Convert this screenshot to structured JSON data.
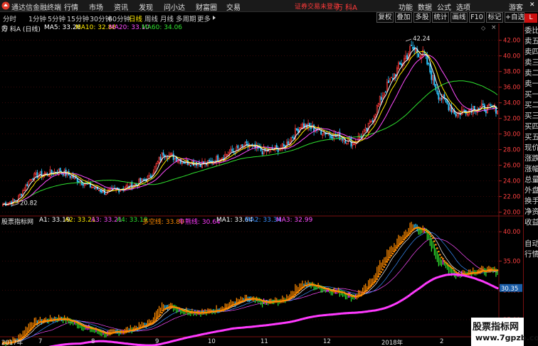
{
  "app": {
    "title": "通达信金融终端"
  },
  "menu": {
    "items": [
      "行情",
      "市场",
      "资讯",
      "发现",
      "问小达",
      "财富圈",
      "交易"
    ]
  },
  "login_text": "证券交易未登录",
  "stock_name": "万 科A",
  "right_menu": {
    "items": [
      "功能",
      "数据",
      "公式",
      "选项",
      "游客"
    ]
  },
  "periods": {
    "items": [
      "分时",
      "1分钟",
      "5分钟",
      "15分钟",
      "30分钟",
      "60分钟",
      "日线",
      "周线",
      "月线",
      "多周期",
      "更多"
    ],
    "active": "日线"
  },
  "toolbar": {
    "items": [
      "复权",
      "叠加",
      "多股",
      "统计",
      "画线",
      "F10",
      "标记",
      "+自选"
    ]
  },
  "ma_legend": {
    "name": "万 科A (日线)",
    "items": [
      {
        "label": "MA5: 33.26",
        "color": "#ffffff"
      },
      {
        "label": "MA10: 32.88",
        "color": "#ffea00"
      },
      {
        "label": "MA20: 33.10",
        "color": "#ff4dff"
      },
      {
        "label": "MA60: 34.06",
        "color": "#2fe12f"
      }
    ]
  },
  "sub_legend": {
    "name": "股票指标网",
    "items": [
      {
        "label": "A1: 33.19",
        "color": "#ffffff"
      },
      {
        "label": "A2: 33.21",
        "color": "#ffea00"
      },
      {
        "label": "A3: 33.21",
        "color": "#ff4dff"
      },
      {
        "label": "A4: 33.19",
        "color": "#2fe12f"
      },
      {
        "label": "多空线: 33.80",
        "color": "#ff8a00"
      },
      {
        "label": "牛熊线: 30.64",
        "color": "#ff3aff"
      },
      {
        "label": "MA1: 33.64",
        "color": "#ffffff"
      },
      {
        "label": "MA2: 33.34",
        "color": "#3a8fff"
      },
      {
        "label": "MA3: 32.99",
        "color": "#ff4dff"
      }
    ]
  },
  "sidebar": {
    "badge": "L",
    "items": [
      "委比",
      "卖五",
      "卖四",
      "卖三",
      "卖二",
      "卖一",
      "买一",
      "买二",
      "买三",
      "买四",
      "买五",
      "现价",
      "涨跌",
      "涨幅",
      "总量",
      "外盘",
      "换手",
      "净资",
      "收益",
      "自动",
      "行情"
    ]
  },
  "watermark": {
    "line1": "股票指标网",
    "line2": "www.7gpzb.com"
  },
  "date_labels": [
    "2017年",
    "7",
    "8",
    "9",
    "10",
    "11",
    "12",
    "2018年",
    "2"
  ],
  "colors": {
    "up": "#ff3a3a",
    "down": "#2ec7ff",
    "ma5": "#ffffff",
    "ma10": "#ffea00",
    "ma20": "#ff4dff",
    "ma60": "#2fe12f"
  },
  "chart_data": [
    {
      "type": "candlestick",
      "title": "万 科A (日线)",
      "ylim": [
        20.0,
        42.24
      ],
      "y_ticks": [
        20.0,
        22.0,
        24.0,
        26.0,
        28.0,
        30.0,
        32.0,
        34.0,
        36.0,
        38.0,
        40.0,
        42.0
      ],
      "high_label": "42.24",
      "low_label": "20.82",
      "x_labels": [
        "2017年",
        "7",
        "8",
        "9",
        "10",
        "11",
        "12",
        "2018年",
        "2"
      ],
      "anchors": [
        {
          "t": 0,
          "v": 21.0
        },
        {
          "t": 10,
          "v": 21.6
        },
        {
          "t": 20,
          "v": 24.5
        },
        {
          "t": 40,
          "v": 25.3
        },
        {
          "t": 58,
          "v": 23.6
        },
        {
          "t": 72,
          "v": 22.5
        },
        {
          "t": 90,
          "v": 23.4
        },
        {
          "t": 102,
          "v": 24.4
        },
        {
          "t": 112,
          "v": 27.6
        },
        {
          "t": 126,
          "v": 26.5
        },
        {
          "t": 143,
          "v": 26.2
        },
        {
          "t": 158,
          "v": 27.6
        },
        {
          "t": 170,
          "v": 28.5
        },
        {
          "t": 182,
          "v": 27.8
        },
        {
          "t": 196,
          "v": 28.3
        },
        {
          "t": 208,
          "v": 31.2
        },
        {
          "t": 222,
          "v": 30.4
        },
        {
          "t": 236,
          "v": 29.6
        },
        {
          "t": 244,
          "v": 28.8
        },
        {
          "t": 254,
          "v": 30.5
        },
        {
          "t": 266,
          "v": 35.5
        },
        {
          "t": 276,
          "v": 38.5
        },
        {
          "t": 285,
          "v": 41.0
        },
        {
          "t": 294,
          "v": 40.0
        },
        {
          "t": 304,
          "v": 35.0
        },
        {
          "t": 316,
          "v": 32.6
        },
        {
          "t": 328,
          "v": 33.4
        },
        {
          "t": 345,
          "v": 33.2
        }
      ],
      "ma_final": {
        "MA5": 33.26,
        "MA10": 32.88,
        "MA20": 33.1,
        "MA60": 34.06
      }
    },
    {
      "type": "line",
      "title": "股票指标网",
      "ylim": [
        22.0,
        42.0
      ],
      "y_ticks": [
        25.0,
        30.0,
        35.0,
        40.0
      ],
      "current_label": "30.35",
      "series": [
        {
          "name": "多空线",
          "final": 33.8
        },
        {
          "name": "牛熊线",
          "final": 30.64
        },
        {
          "name": "MA1",
          "final": 33.64
        },
        {
          "name": "MA2",
          "final": 33.34
        },
        {
          "name": "MA3",
          "final": 32.99
        }
      ]
    }
  ]
}
